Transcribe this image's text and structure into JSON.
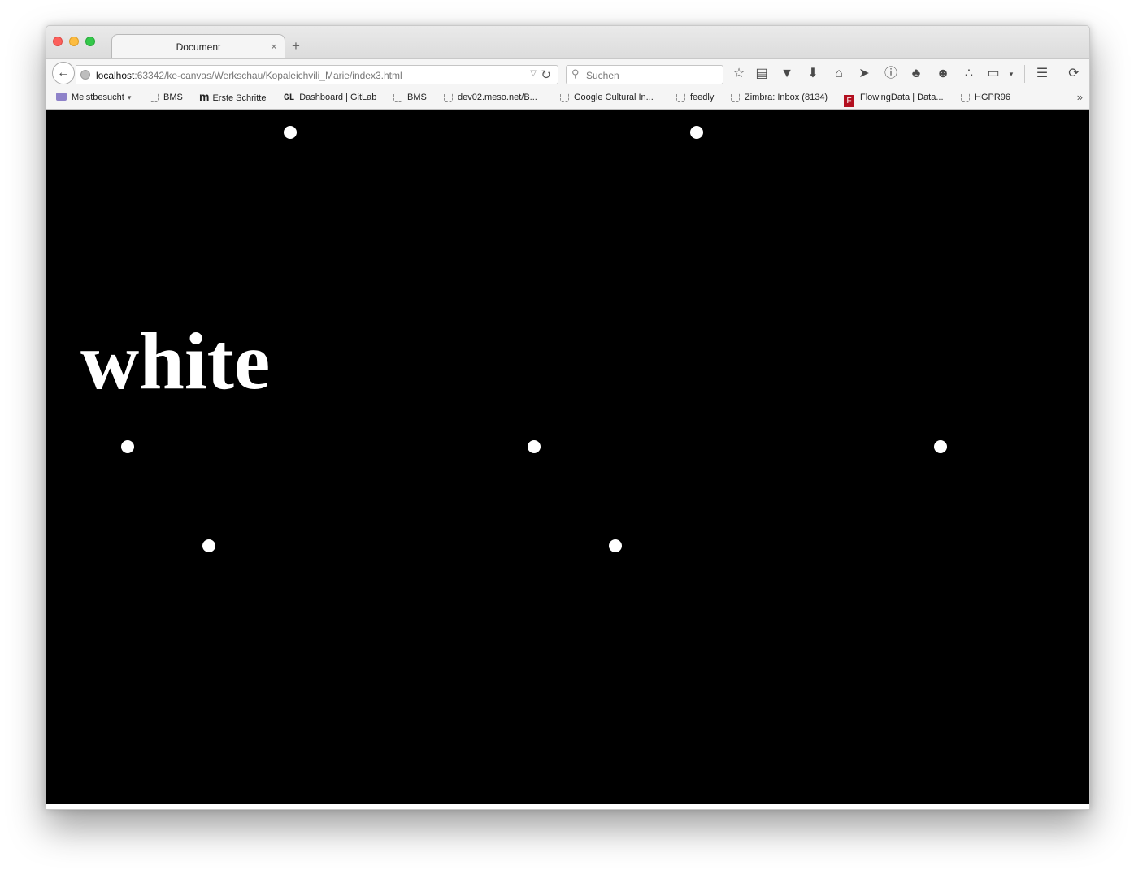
{
  "tab": {
    "title": "Document",
    "close": "×",
    "new_tab": "+"
  },
  "urlbar": {
    "host": "localhost",
    "rest": ":63342/ke-canvas/Werkschau/Kopaleichvili_Marie/index3.html"
  },
  "search": {
    "placeholder": "Suchen"
  },
  "bookmarks": [
    {
      "label": "Meistbesucht",
      "icon": "folder"
    },
    {
      "label": "BMS",
      "icon": "placeholder"
    },
    {
      "label": "Erste Schritte",
      "icon": "m-logo"
    },
    {
      "label": "Dashboard | GitLab",
      "icon": "gl-logo"
    },
    {
      "label": "BMS",
      "icon": "placeholder"
    },
    {
      "label": "dev02.meso.net/B...",
      "icon": "placeholder"
    },
    {
      "label": "Google Cultural In...",
      "icon": "placeholder"
    },
    {
      "label": "feedly",
      "icon": "placeholder"
    },
    {
      "label": "Zimbra: Inbox (8134)",
      "icon": "placeholder"
    },
    {
      "label": "FlowingData | Data...",
      "icon": "flowingdata-logo"
    },
    {
      "label": "HGPR96",
      "icon": "placeholder"
    }
  ],
  "content": {
    "word": "white",
    "background": "#000000",
    "foreground": "#ffffff"
  }
}
